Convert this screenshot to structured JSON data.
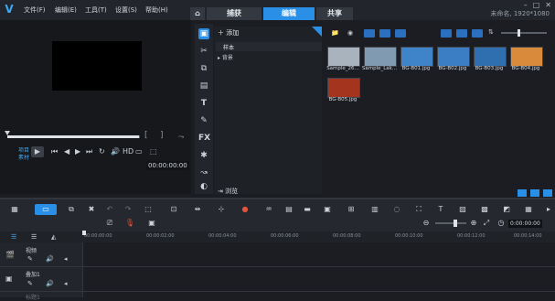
{
  "menu": {
    "items": [
      "文件(F)",
      "编辑(E)",
      "工具(T)",
      "设置(S)",
      "帮助(H)"
    ]
  },
  "tabs": {
    "home": "⌂",
    "capture": "捕获",
    "edit": "编辑",
    "share": "共享"
  },
  "project_info": "未命名, 1920*1080",
  "player": {
    "project_label": "项目",
    "clip_label": "素材",
    "hd_label": "HD",
    "timecode": "00:00:00:00"
  },
  "library": {
    "add_label": "添加",
    "folders": [
      "样本",
      "背景"
    ],
    "browse_label": "浏览"
  },
  "media": {
    "thumbnails": [
      {
        "name": "Sample_26...",
        "color": "#a9b3bd"
      },
      {
        "name": "Sample_Lak...",
        "color": "#7f9ab1"
      },
      {
        "name": "BG-B01.jpg",
        "color": "#3f84c8"
      },
      {
        "name": "BG-B02.jpg",
        "color": "#3c7ec3"
      },
      {
        "name": "BG-B03.jpg",
        "color": "#2f6fb0"
      },
      {
        "name": "BG-B04.jpg",
        "color": "#d98a3a"
      },
      {
        "name": "BG-B05.jpg",
        "color": "#a4341e"
      }
    ]
  },
  "timeline": {
    "ruler_labels": [
      "00:00:00:00",
      "00:00:02:00",
      "00:00:04:00",
      "00:00:06:00",
      "00:00:08:00",
      "00:00:10:00",
      "00:00:12:00",
      "00:00:14:00"
    ],
    "zoom_value": "0:00:00:00",
    "tracks": [
      "视频",
      "叠加1",
      "标题1"
    ]
  },
  "colors": {
    "accent": "#2a8fe6",
    "background": "#1b1d22"
  }
}
